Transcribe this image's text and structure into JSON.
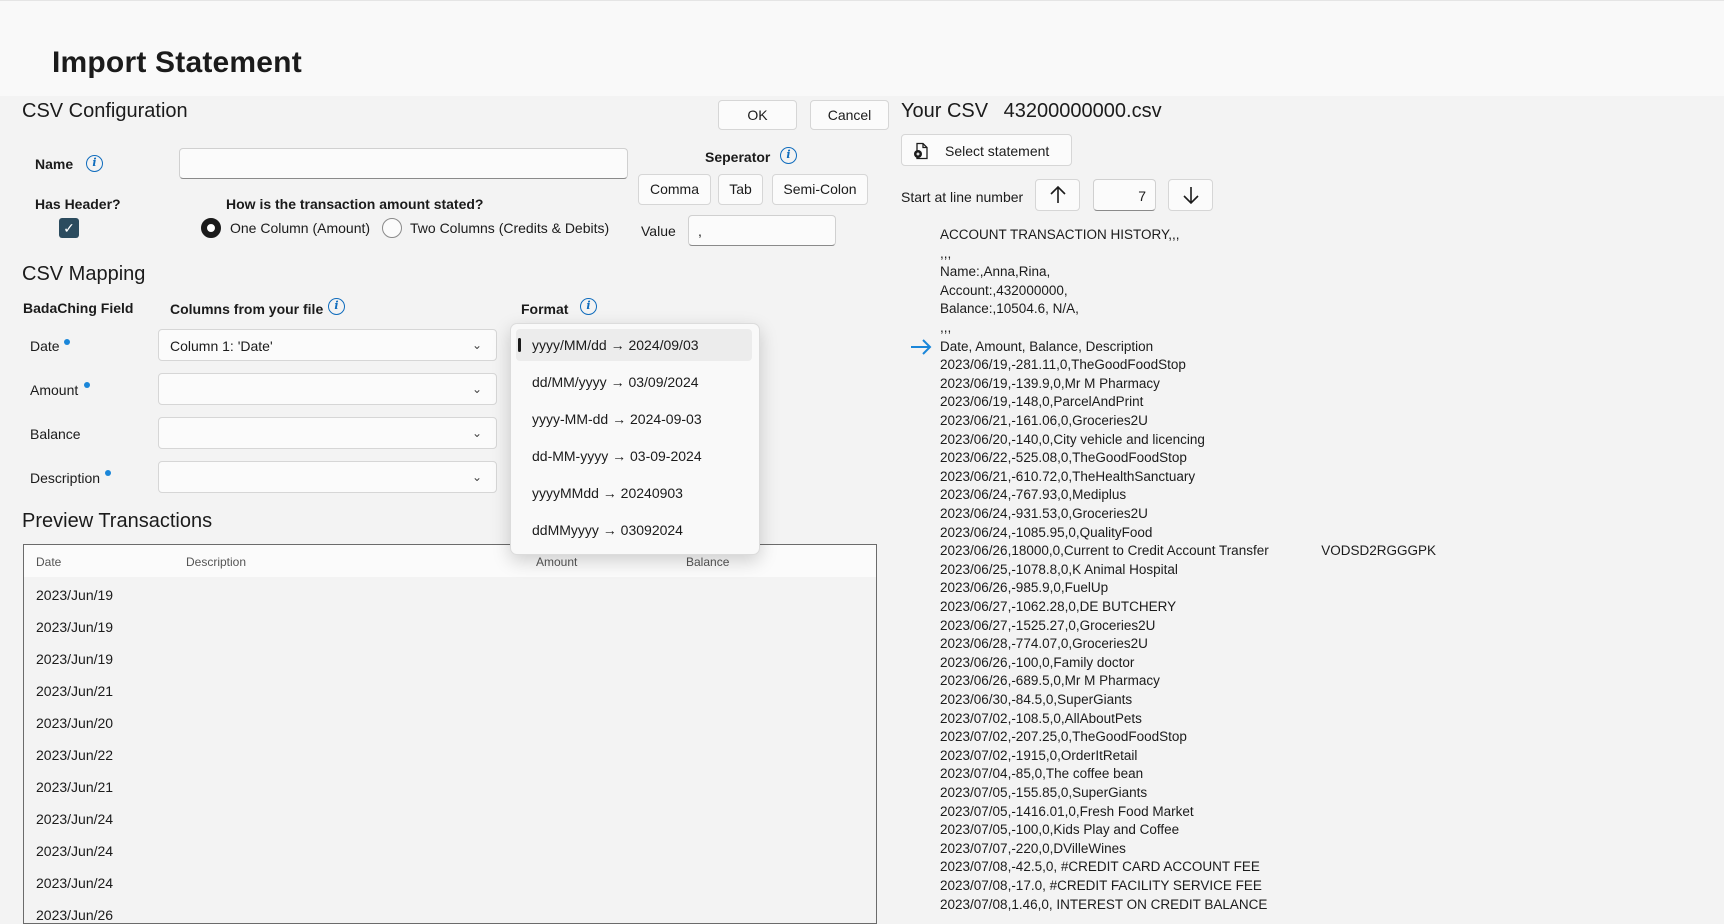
{
  "page": {
    "title": "Import Statement"
  },
  "csv_config": {
    "title": "CSV Configuration",
    "ok_label": "OK",
    "cancel_label": "Cancel",
    "name_label": "Name",
    "name_value": "",
    "has_header_label": "Has Header?",
    "has_header_checked": true,
    "amount_question": "How is the transaction amount stated?",
    "radio_one_column": "One Column (Amount)",
    "radio_two_columns": "Two Columns (Credits & Debits)",
    "separator_label": "Seperator",
    "sep_comma": "Comma",
    "sep_tab": "Tab",
    "sep_semicolon": "Semi-Colon",
    "value_label": "Value",
    "value_value": ","
  },
  "mapping": {
    "title": "CSV Mapping",
    "col_field": "BadaChing Field",
    "col_columns": "Columns from your file",
    "col_format": "Format",
    "fields": [
      {
        "label": "Date",
        "required": true,
        "value": "Column 1: 'Date'"
      },
      {
        "label": "Amount",
        "required": true,
        "value": ""
      },
      {
        "label": "Balance",
        "required": false,
        "value": ""
      },
      {
        "label": "Description",
        "required": true,
        "value": ""
      }
    ],
    "format_options": [
      "yyyy/MM/dd → 2024/09/03",
      "dd/MM/yyyy → 03/09/2024",
      "yyyy-MM-dd → 2024-09-03",
      "dd-MM-yyyy → 03-09-2024",
      "yyyyMMdd → 20240903",
      "ddMMyyyy → 03092024"
    ],
    "format_selected": "yyyy/MM/dd → 2024/09/03"
  },
  "preview": {
    "title": "Preview Transactions",
    "headers": {
      "date": "Date",
      "description": "Description",
      "amount": "Amount",
      "balance": "Balance"
    },
    "rows": [
      "2023/Jun/19",
      "2023/Jun/19",
      "2023/Jun/19",
      "2023/Jun/21",
      "2023/Jun/20",
      "2023/Jun/22",
      "2023/Jun/21",
      "2023/Jun/24",
      "2023/Jun/24",
      "2023/Jun/24",
      "2023/Jun/26"
    ]
  },
  "csv_panel": {
    "title_prefix": "Your CSV",
    "filename": "43200000000.csv",
    "select_label": "Select statement",
    "start_line_label": "Start at line number",
    "start_line_value": "7",
    "lines": [
      "ACCOUNT TRANSACTION HISTORY,,,",
      ",,,",
      "Name:,Anna,Rina,",
      "Account:,432000000,",
      "Balance:,10504.6, N/A,",
      ",,,",
      "Date, Amount, Balance, Description",
      "2023/06/19,-281.11,0,TheGoodFoodStop",
      "2023/06/19,-139.9,0,Mr M Pharmacy",
      "2023/06/19,-148,0,ParcelAndPrint",
      "2023/06/21,-161.06,0,Groceries2U",
      "2023/06/20,-140,0,City vehicle and licencing",
      "2023/06/22,-525.08,0,TheGoodFoodStop",
      "2023/06/21,-610.72,0,TheHealthSanctuary",
      "2023/06/24,-767.93,0,Mediplus",
      "2023/06/24,-931.53,0,Groceries2U",
      "2023/06/24,-1085.95,0,QualityFood",
      "2023/06/26,18000,0,Current to Credit Account Transfer              VODSD2RGGGPK",
      "2023/06/25,-1078.8,0,K Animal Hospital",
      "2023/06/26,-985.9,0,FuelUp",
      "2023/06/27,-1062.28,0,DE BUTCHERY",
      "2023/06/27,-1525.27,0,Groceries2U",
      "2023/06/28,-774.07,0,Groceries2U",
      "2023/06/26,-100,0,Family doctor",
      "2023/06/26,-689.5,0,Mr M Pharmacy",
      "2023/06/30,-84.5,0,SuperGiants",
      "2023/07/02,-108.5,0,AllAboutPets",
      "2023/07/02,-207.25,0,TheGoodFoodStop",
      "2023/07/02,-1915,0,OrderItRetail",
      "2023/07/04,-85,0,The coffee bean",
      "2023/07/05,-155.85,0,SuperGiants",
      "2023/07/05,-1416.01,0,Fresh Food Market",
      "2023/07/05,-100,0,Kids Play and Coffee",
      "2023/07/07,-220,0,DVilleWines",
      "2023/07/08,-42.5,0, #CREDIT CARD ACCOUNT FEE",
      "2023/07/08,-17.0, #CREDIT FACILITY SERVICE FEE",
      "2023/07/08,1.46,0, INTEREST ON CREDIT BALANCE"
    ],
    "marker_line_index": 6
  },
  "colors": {
    "accent": "#0f6cbd",
    "required_dot": "#1a86d9",
    "arrow": "#1a86d9"
  }
}
